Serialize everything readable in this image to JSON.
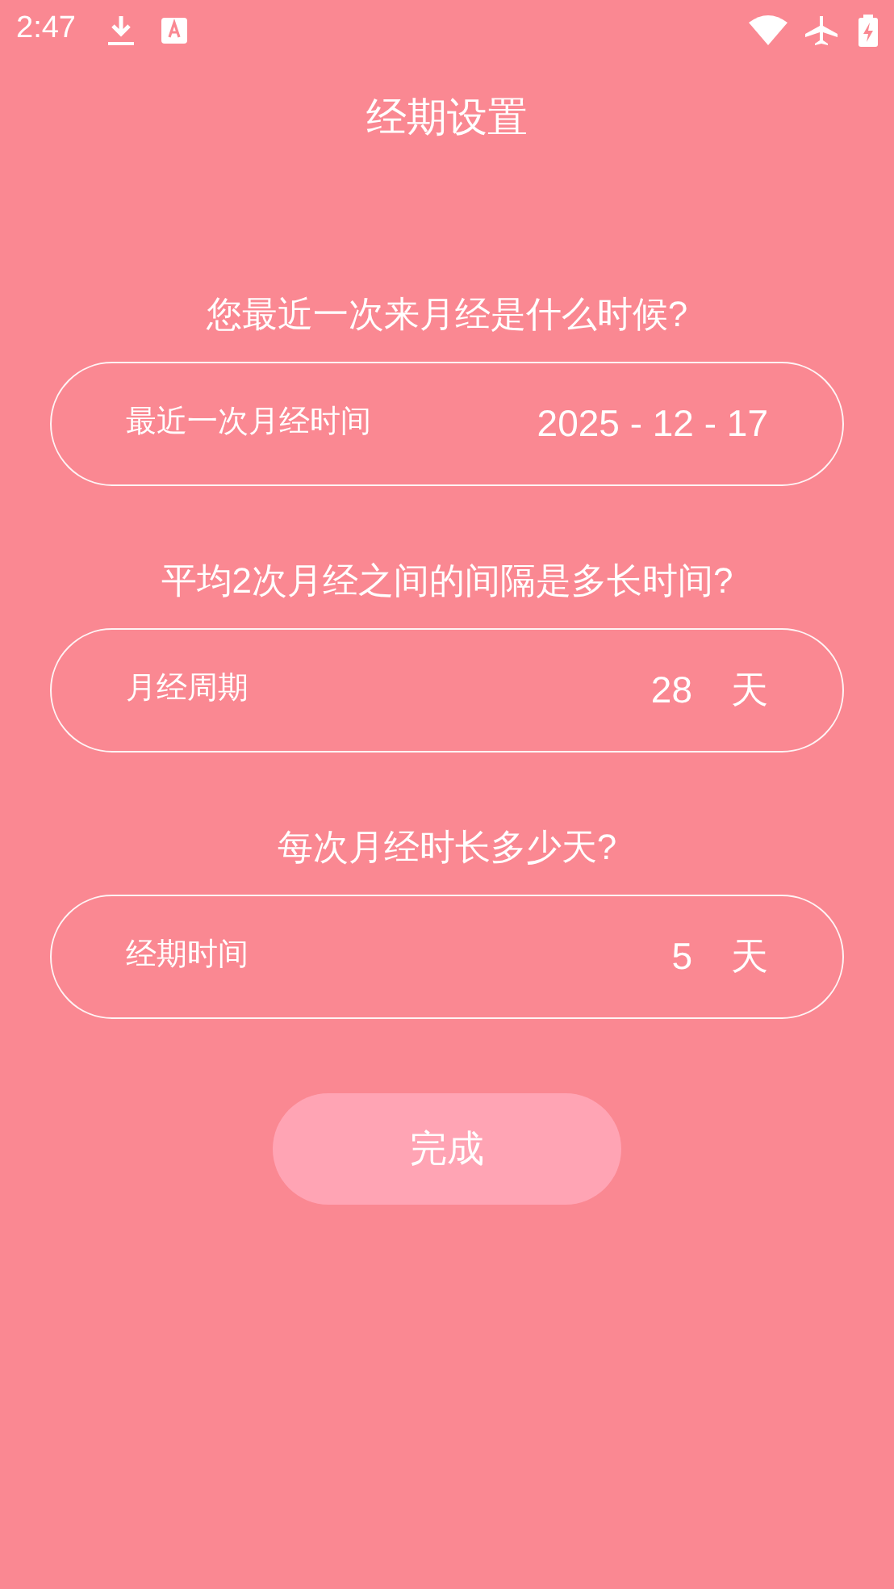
{
  "status_bar": {
    "time": "2:47"
  },
  "title": "经期设置",
  "sections": [
    {
      "question": "您最近一次来月经是什么时候?",
      "label": "最近一次月经时间",
      "value": "2025 - 12 - 17"
    },
    {
      "question": "平均2次月经之间的间隔是多长时间?",
      "label": "月经周期",
      "value": "28",
      "unit": "天"
    },
    {
      "question": "每次月经时长多少天?",
      "label": "经期时间",
      "value": "5",
      "unit": "天"
    }
  ],
  "button": "完成"
}
